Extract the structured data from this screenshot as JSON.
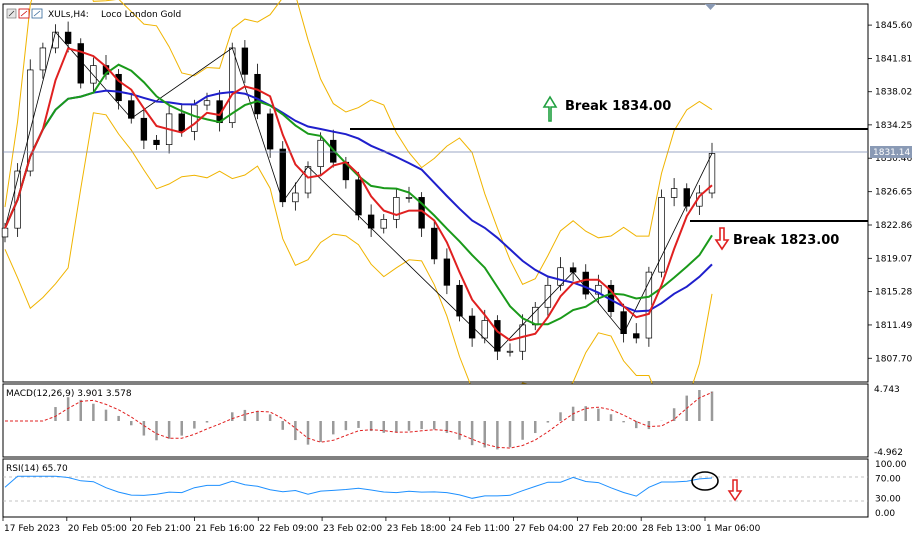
{
  "header": {
    "symbol": "XULs,H4:",
    "instrument": "Loco London Gold"
  },
  "price_axis": {
    "ticks": [
      "1845.60",
      "1841.81",
      "1838.02",
      "1834.25",
      "1830.46",
      "1826.65",
      "1822.86",
      "1819.07",
      "1815.28",
      "1811.49",
      "1807.70"
    ],
    "current_price": "1831.14"
  },
  "annotations": {
    "break_up": "Break 1834.00",
    "break_down": "Break 1823.00"
  },
  "macd": {
    "label": "MACD(12,26,9) 3.901 3.578",
    "max_label": "4.743",
    "min_label": "-4.962"
  },
  "rsi": {
    "label": "RSI(14) 65.70",
    "ticks": [
      "100.00",
      "70.00",
      "30.00",
      "0.00"
    ]
  },
  "time_axis": {
    "labels": [
      "17 Feb 2023",
      "20 Feb 05:00",
      "20 Feb 21:00",
      "21 Feb 16:00",
      "22 Feb 09:00",
      "23 Feb 02:00",
      "23 Feb 18:00",
      "24 Feb 11:00",
      "27 Feb 04:00",
      "27 Feb 20:00",
      "28 Feb 13:00",
      "1 Mar 06:00"
    ]
  },
  "colors": {
    "ma_fast": "#e02020",
    "ma_mid": "#1a9a1a",
    "ma_slow": "#1f1fcc",
    "bollinger": "#f0b400",
    "rsi_line": "#1e90ff",
    "macd_signal": "#e02020",
    "up_arrow": "#20a040",
    "down_arrow": "#e02020"
  },
  "chart_data": {
    "type": "line",
    "title": "",
    "series": [
      {
        "values": [
          1822.5,
          1829.0,
          1840.5,
          1843.0,
          1844.8,
          1843.5,
          1839.0,
          1841.0,
          1840.0,
          1837.0,
          1835.0,
          1832.5,
          1832.0,
          1835.5,
          1833.5,
          1836.5,
          1837.0,
          1834.5,
          1843.0,
          1840.0,
          1835.5,
          1831.5,
          1825.5,
          1826.5,
          1829.5,
          1832.5,
          1830.0,
          1828.0,
          1824.0,
          1822.5,
          1823.5,
          1826.0,
          1826.0,
          1822.5,
          1819.0,
          1816.0,
          1812.5,
          1810.0,
          1812.0,
          1808.5,
          1808.5,
          1811.5,
          1813.5,
          1816.0,
          1818.0,
          1817.5,
          1815.0,
          1816.0,
          1813.0,
          1810.5,
          1810.0,
          1817.5,
          1826.0,
          1827.0,
          1825.0,
          1826.5,
          1831.0
        ]
      }
    ],
    "ylim": [
      1805.0,
      1848.0
    ]
  }
}
